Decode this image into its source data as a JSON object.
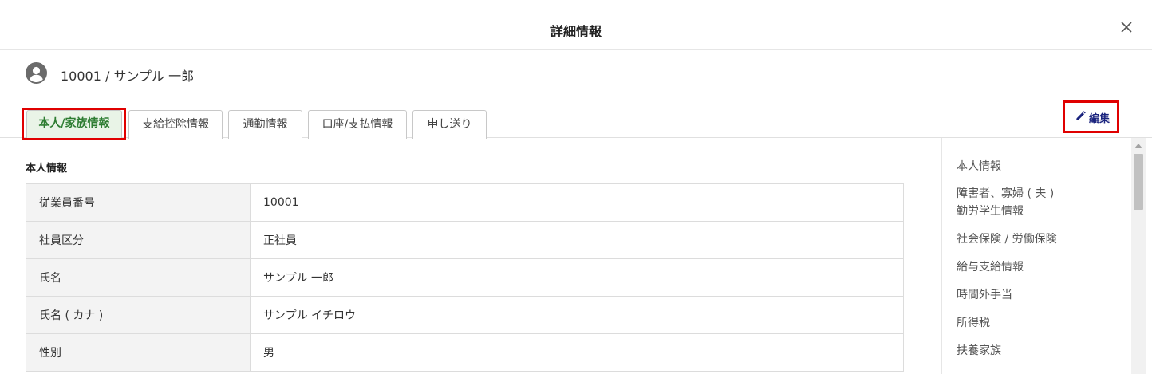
{
  "modal": {
    "title": "詳細情報",
    "close_icon": "close-icon"
  },
  "employee": {
    "avatar_icon": "user-circle-icon",
    "label": "10001 / サンプル 一郎"
  },
  "tabs": [
    {
      "label": "本人/家族情報",
      "active": true
    },
    {
      "label": "支給控除情報",
      "active": false
    },
    {
      "label": "通勤情報",
      "active": false
    },
    {
      "label": "口座/支払情報",
      "active": false
    },
    {
      "label": "申し送り",
      "active": false
    }
  ],
  "toolbar": {
    "edit_label": "編集",
    "edit_icon": "pencil-icon"
  },
  "section": {
    "title": "本人情報"
  },
  "table": {
    "rows": [
      {
        "label": "従業員番号",
        "value": "10001"
      },
      {
        "label": "社員区分",
        "value": "正社員"
      },
      {
        "label": "氏名",
        "value": "サンプル 一郎"
      },
      {
        "label": "氏名 ( カナ )",
        "value": "サンプル イチロウ"
      },
      {
        "label": "性別",
        "value": "男"
      }
    ]
  },
  "side_nav": {
    "items": [
      {
        "label": "本人情報"
      },
      {
        "label": "障害者、寡婦 ( 夫 )",
        "label2": "勤労学生情報"
      },
      {
        "label": "社会保険 / 労働保険"
      },
      {
        "label": "給与支給情報"
      },
      {
        "label": "時間外手当"
      },
      {
        "label": "所得税"
      },
      {
        "label": "扶養家族"
      }
    ]
  },
  "colors": {
    "active_tab_text": "#2e7d32",
    "active_tab_bg": "#e9f4e7",
    "edit_text": "#1a237e",
    "highlight": "#e00000"
  }
}
